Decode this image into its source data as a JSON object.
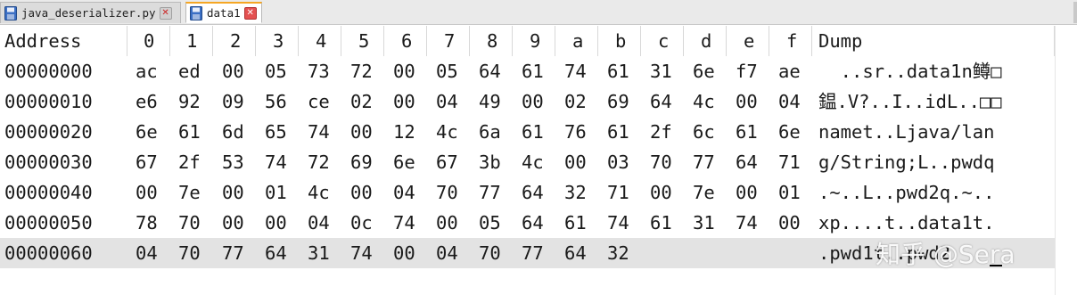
{
  "tabs": [
    {
      "label": "java_deserializer.py",
      "active": false,
      "icon": "save-file-icon"
    },
    {
      "label": "data1",
      "active": true,
      "icon": "save-file-icon"
    }
  ],
  "colors": {
    "tab_accent": "#f5a623",
    "close_active": "#e45050",
    "row_highlight": "#e3e3e3"
  },
  "hex_view": {
    "headers": [
      "Address",
      "0",
      "1",
      "2",
      "3",
      "4",
      "5",
      "6",
      "7",
      "8",
      "9",
      "a",
      "b",
      "c",
      "d",
      "e",
      "f",
      "Dump"
    ],
    "rows": [
      {
        "address": "00000000",
        "bytes": [
          "ac",
          "ed",
          "00",
          "05",
          "73",
          "72",
          "00",
          "05",
          "64",
          "61",
          "74",
          "61",
          "31",
          "6e",
          "f7",
          "ae"
        ],
        "dump": "  ..sr..data1n鳟□"
      },
      {
        "address": "00000010",
        "bytes": [
          "e6",
          "92",
          "09",
          "56",
          "ce",
          "02",
          "00",
          "04",
          "49",
          "00",
          "02",
          "69",
          "64",
          "4c",
          "00",
          "04"
        ],
        "dump": "鎾.V?..I..idL..□□"
      },
      {
        "address": "00000020",
        "bytes": [
          "6e",
          "61",
          "6d",
          "65",
          "74",
          "00",
          "12",
          "4c",
          "6a",
          "61",
          "76",
          "61",
          "2f",
          "6c",
          "61",
          "6e"
        ],
        "dump": "namet..Ljava/lan"
      },
      {
        "address": "00000030",
        "bytes": [
          "67",
          "2f",
          "53",
          "74",
          "72",
          "69",
          "6e",
          "67",
          "3b",
          "4c",
          "00",
          "03",
          "70",
          "77",
          "64",
          "71"
        ],
        "dump": "g/String;L..pwdq"
      },
      {
        "address": "00000040",
        "bytes": [
          "00",
          "7e",
          "00",
          "01",
          "4c",
          "00",
          "04",
          "70",
          "77",
          "64",
          "32",
          "71",
          "00",
          "7e",
          "00",
          "01"
        ],
        "dump": ".~..L..pwd2q.~.."
      },
      {
        "address": "00000050",
        "bytes": [
          "78",
          "70",
          "00",
          "00",
          "04",
          "0c",
          "74",
          "00",
          "05",
          "64",
          "61",
          "74",
          "61",
          "31",
          "74",
          "00"
        ],
        "dump": "xp....t..data1t."
      },
      {
        "address": "00000060",
        "bytes": [
          "04",
          "70",
          "77",
          "64",
          "31",
          "74",
          "00",
          "04",
          "70",
          "77",
          "64",
          "32",
          "",
          "",
          "",
          ""
        ],
        "dump": ".pwd1t..pwd2"
      }
    ]
  },
  "watermark": "知乎 @Sera"
}
